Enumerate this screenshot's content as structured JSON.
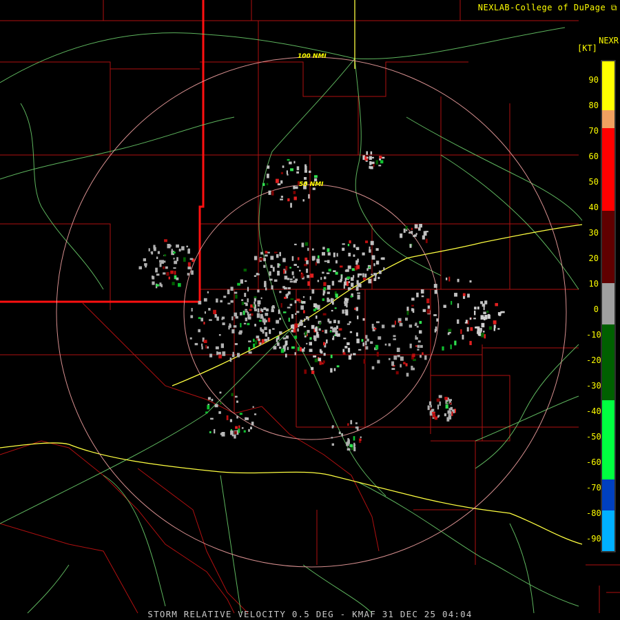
{
  "header": {
    "credit": "NEXLAB-College of DuPage",
    "product_tag": "NEXR",
    "unit": "[KT]"
  },
  "range_rings": [
    {
      "label": "100 NMI",
      "radius_nmi": 100
    },
    {
      "label": "50 NMI",
      "radius_nmi": 50
    }
  ],
  "legend": {
    "ticks": [
      "90",
      "80",
      "70",
      "60",
      "50",
      "40",
      "30",
      "20",
      "10",
      "0",
      "-10",
      "-20",
      "-30",
      "-40",
      "-50",
      "-60",
      "-70",
      "-80",
      "-90"
    ],
    "colors": {
      "top": "#ffff00",
      "orange": "#f0a060",
      "red": "#ff0000",
      "darkred": "#600000",
      "gray": "#a0a0a0",
      "darkgreen": "#006000",
      "green": "#00ff40",
      "blue": "#0040c0",
      "cyan": "#00b0ff"
    }
  },
  "footer": {
    "caption": "STORM RELATIVE VELOCITY 0.5 DEG - KMAF 31 DEC 25 04:04"
  }
}
